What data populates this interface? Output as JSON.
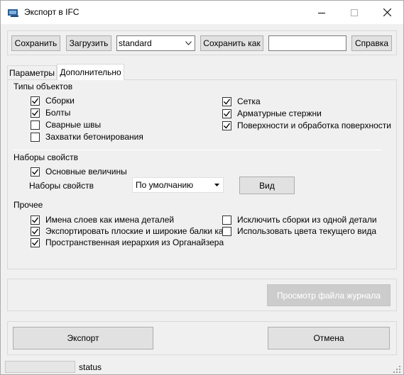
{
  "window": {
    "title": "Экспорт в IFC",
    "icon": "ifc-export-app-icon"
  },
  "toolbar": {
    "save_label": "Сохранить",
    "load_label": "Загрузить",
    "preset_value": "standard",
    "save_as_label": "Сохранить как",
    "save_as_name_value": "",
    "help_label": "Справка"
  },
  "tabs": [
    {
      "label": "Параметры",
      "active": false
    },
    {
      "label": "Дополнительно",
      "active": true
    }
  ],
  "object_types": {
    "label": "Типы объектов",
    "left": [
      {
        "label": "Сборки",
        "checked": true
      },
      {
        "label": "Болты",
        "checked": true
      },
      {
        "label": "Сварные швы",
        "checked": false
      },
      {
        "label": "Захватки бетонирования",
        "checked": false
      }
    ],
    "right": [
      {
        "label": "Сетка",
        "checked": true
      },
      {
        "label": "Арматурные стержни",
        "checked": true
      },
      {
        "label": "Поверхности и обработка поверхности",
        "checked": true
      }
    ]
  },
  "property_sets": {
    "label": "Наборы свойств",
    "base_quantities": {
      "label": "Основные величины",
      "checked": true
    },
    "sets_label": "Наборы свойств",
    "sets_value": "По умолчанию",
    "view_label": "Вид"
  },
  "other": {
    "label": "Прочее",
    "left": [
      {
        "label": "Имена слоев как имена деталей",
        "checked": true
      },
      {
        "label": "Экспортировать плоские и широкие балки как п",
        "checked": true
      },
      {
        "label": "Пространственная иерархия из Органайзера",
        "checked": true
      }
    ],
    "right": [
      {
        "label": "Исключить сборки из одной детали",
        "checked": false
      },
      {
        "label": "Использовать цвета текущего вида",
        "checked": false
      }
    ]
  },
  "log_view_label": "Просмотр файла журнала",
  "export_label": "Экспорт",
  "cancel_label": "Отмена",
  "status": {
    "text": "status"
  }
}
